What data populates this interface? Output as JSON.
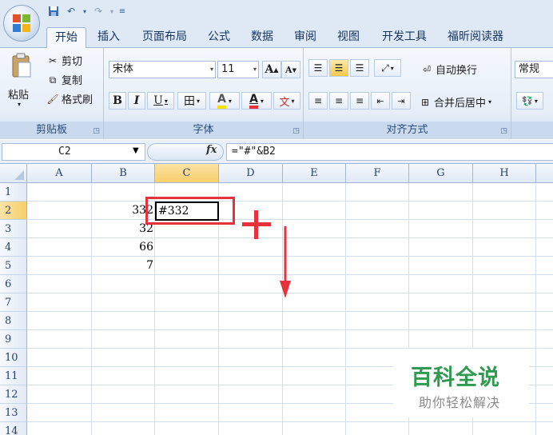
{
  "tabs": [
    "开始",
    "插入",
    "页面布局",
    "公式",
    "数据",
    "审阅",
    "视图",
    "开发工具",
    "福昕阅读器"
  ],
  "clipboard": {
    "paste": "粘贴",
    "cut": "剪切",
    "copy": "复制",
    "format_painter": "格式刷",
    "group_label": "剪贴板"
  },
  "font": {
    "name": "宋体",
    "size": "11",
    "grow": "A",
    "shrink": "A",
    "bold": "B",
    "italic": "I",
    "underline": "U",
    "border": "田",
    "highlight": "A",
    "color": "A",
    "phonetic": "文",
    "group_label": "字体"
  },
  "alignment": {
    "wrap_text": "自动换行",
    "merge_center": "合并后居中",
    "group_label": "对齐方式"
  },
  "number": {
    "format": "常规"
  },
  "formula_bar": {
    "name_box": "C2",
    "fx": "fx",
    "formula": "=\"#\"&B2"
  },
  "columns": [
    "A",
    "B",
    "C",
    "D",
    "E",
    "F",
    "G",
    "H"
  ],
  "rows": [
    "1",
    "2",
    "3",
    "4",
    "5",
    "6",
    "7",
    "8",
    "9",
    "10",
    "11",
    "12",
    "13",
    "14"
  ],
  "cells": {
    "B2": "332",
    "B3": "32",
    "B4": "66",
    "B5": "7",
    "C2": "#332"
  },
  "colors": {
    "annotation_red": "#e5323c",
    "watermark_green": "#2f9a50",
    "selected_header": "#f8cf6a"
  },
  "watermark": {
    "title": "百科全说",
    "subtitle": "助你轻松解决"
  }
}
